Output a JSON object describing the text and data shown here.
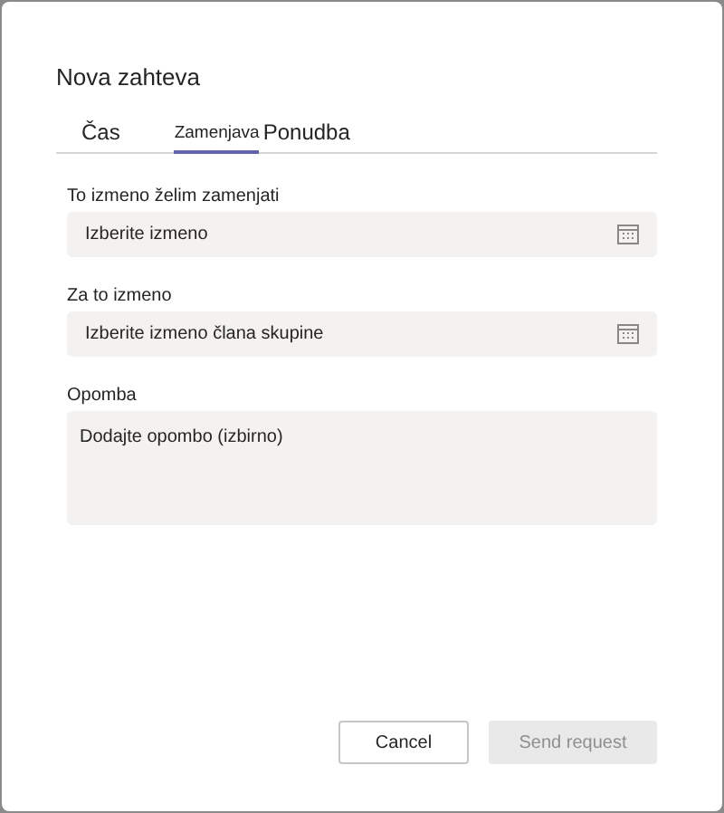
{
  "dialog": {
    "title": "Nova zahteva"
  },
  "tabs": [
    {
      "label": "Čas",
      "selected": false
    },
    {
      "label": "Zamenjava",
      "selected": true
    },
    {
      "label": "Ponudba",
      "selected": false
    }
  ],
  "fields": [
    {
      "kind": "picker",
      "label": "To izmeno želim zamenjati",
      "placeholder": "Izberite izmeno"
    },
    {
      "kind": "picker",
      "label": "Za to izmeno",
      "placeholder": "Izberite izmeno člana skupine"
    },
    {
      "kind": "note",
      "label": "Opomba",
      "placeholder": "Dodajte opombo (izbirno)"
    }
  ],
  "buttons": [
    {
      "label": "Cancel",
      "disabled": false
    },
    {
      "label": "Send request",
      "disabled": true
    }
  ]
}
